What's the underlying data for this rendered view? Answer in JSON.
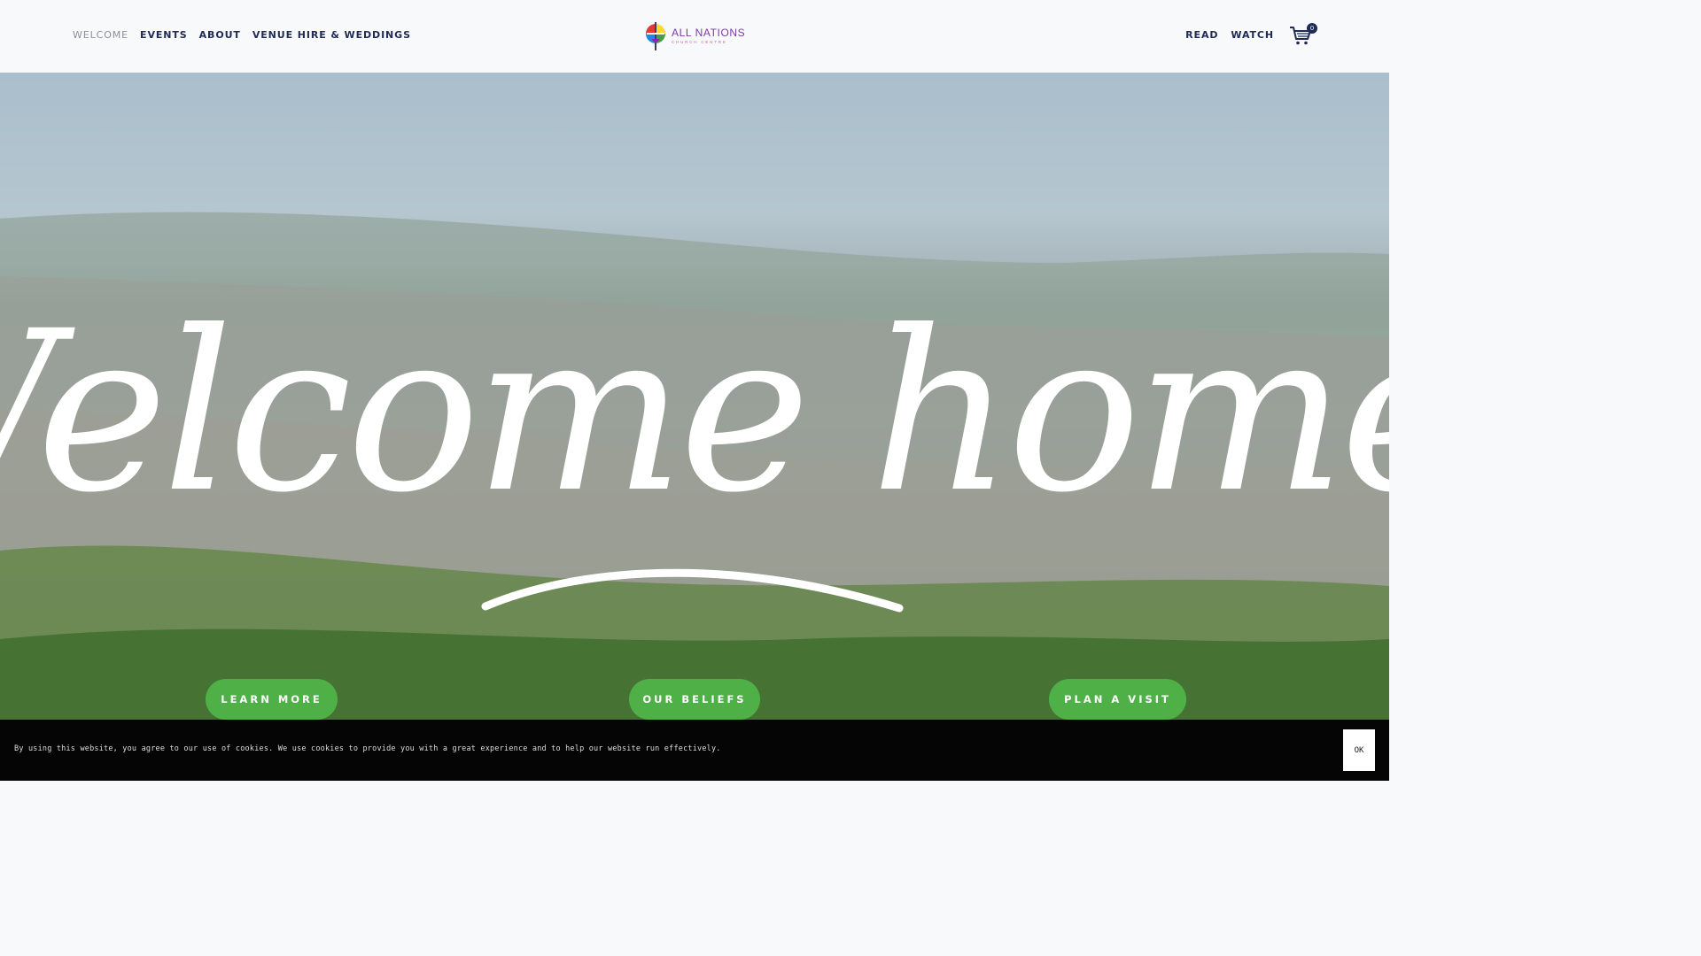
{
  "nav": {
    "left": [
      {
        "label": "WELCOME",
        "active": true
      },
      {
        "label": "EVENTS",
        "active": false
      },
      {
        "label": "ABOUT",
        "active": false
      },
      {
        "label": "VENUE HIRE & WEDDINGS",
        "active": false
      }
    ],
    "right": [
      {
        "label": "READ"
      },
      {
        "label": "WATCH"
      }
    ]
  },
  "logo": {
    "main": "ALL NATIONS",
    "sub": "CHURCH CENTRE",
    "colors": [
      "#e53935",
      "#fdd835",
      "#43a047",
      "#1e88e5",
      "#8e24aa"
    ]
  },
  "cart": {
    "icon": "cart-icon",
    "count": "0"
  },
  "hero": {
    "headline": "Welcome home!",
    "buttons": [
      {
        "label": "LEARN MORE"
      },
      {
        "label": "OUR BELIEFS"
      },
      {
        "label": "PLAN A VISIT"
      }
    ],
    "button_color": "#4fb048"
  },
  "cookie": {
    "text": "By using this website, you agree to our use of cookies. We use cookies to provide you with a great experience and to help our website run effectively.",
    "ok_label": "OK"
  }
}
